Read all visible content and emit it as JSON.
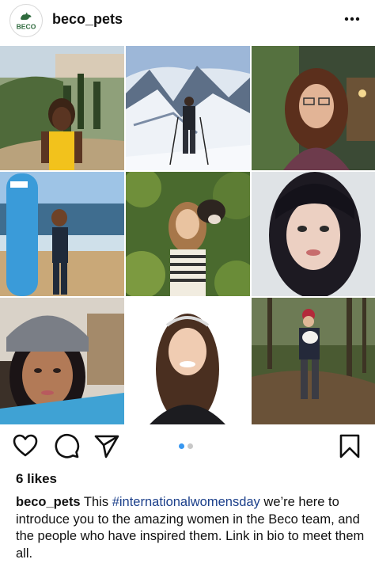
{
  "post": {
    "account": {
      "username": "beco_pets",
      "avatar_logo_text": "BECO",
      "avatar_icon": "beco-dog-logo-icon"
    },
    "menu_icon": "more-options-icon",
    "photos": [
      {
        "label": "woman-yellow-top-hillside"
      },
      {
        "label": "skier-snowy-mountains"
      },
      {
        "label": "woman-curly-hair-glasses"
      },
      {
        "label": "woman-surfboard-beach"
      },
      {
        "label": "woman-holding-dog-leaves"
      },
      {
        "label": "woman-dark-hair-selfie"
      },
      {
        "label": "woman-grey-beanie"
      },
      {
        "label": "woman-headband-portrait"
      },
      {
        "label": "woman-dog-muddy-woods"
      }
    ],
    "actions": {
      "like_icon": "heart-icon",
      "comment_icon": "comment-icon",
      "share_icon": "send-icon",
      "save_icon": "bookmark-icon"
    },
    "carousel": {
      "total": 2,
      "active": 1
    },
    "likes": "6 likes",
    "caption": {
      "username": "beco_pets",
      "text_before": "This ",
      "hashtag": "#internationalwomensday",
      "text_after": " we’re here to introduce you to the amazing women in the Beco team, and the people who have inspired them. Link in bio to meet them all."
    },
    "colors": {
      "brand_green": "#2f6b3e",
      "link_blue": "#1b3f8a",
      "dot_active": "#3897f0"
    }
  }
}
